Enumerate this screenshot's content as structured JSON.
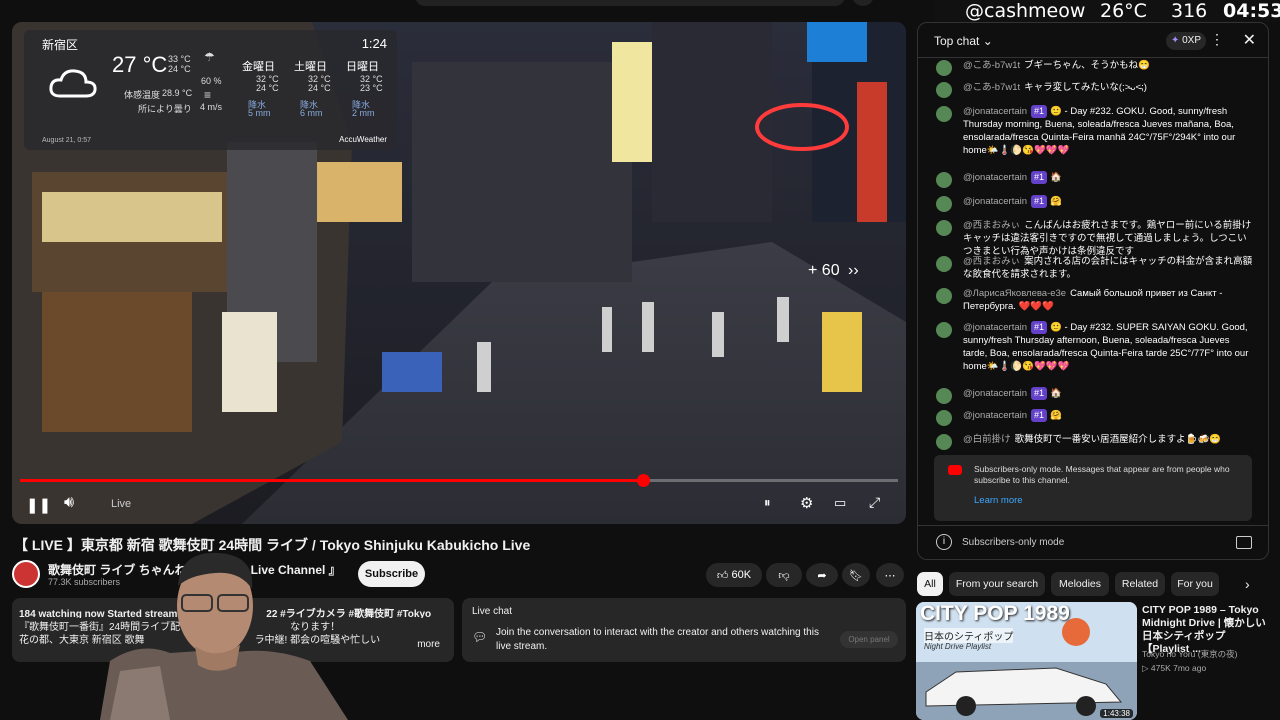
{
  "stream_overlay": {
    "handle": "@cashmeow",
    "temp": "26°C",
    "count": "316",
    "clock": "04:53"
  },
  "video": {
    "weather": {
      "location": "新宿区",
      "time": "1:24",
      "temp": "27 °C",
      "hi": "33 °C",
      "lo": "24 °C",
      "rain_pct": "60 %",
      "feels_label": "体感温度",
      "feels": "28.9 °C",
      "condition": "所により曇り",
      "wind": "4 m/s",
      "days": [
        {
          "label": "金曜日",
          "hi": "32 °C",
          "lo": "24 °C",
          "rain_label": "降水",
          "rain": "5 mm"
        },
        {
          "label": "土曜日",
          "hi": "32 °C",
          "lo": "24 °C",
          "rain_label": "降水",
          "rain": "6 mm"
        },
        {
          "label": "日曜日",
          "hi": "32 °C",
          "lo": "23 °C",
          "rain_label": "降水",
          "rain": "2 mm"
        }
      ],
      "footer": "August 21, 0:57",
      "provider": "AccuWeather"
    },
    "seek_hint": "+ 60",
    "live_label": "Live",
    "progress": 0.71
  },
  "title": "【 LIVE 】東京都 新宿 歌舞伎町 24時間 ライブ / Tokyo Shinjuku Kabukicho Live",
  "channel": {
    "name": "歌舞伎町 ライブ ちゃんね",
    "name_end": "o Live Channel 』",
    "subs": "77.3K subscribers",
    "subscribe": "Subscribe"
  },
  "actions": {
    "likes": "60K"
  },
  "description": {
    "line1": "184 watching now  Started streamin",
    "line1b": "22  #ライブカメラ #歌舞伎町 #Tokyo",
    "line2": "『歌舞伎町一番街』24時間ライブ配",
    "line2b": "なります！",
    "line3": "花の都、大東京 新宿区 歌舞",
    "line3b": "ラ中継! 都会の喧騒や忙しい",
    "more": "more"
  },
  "live_chat_box": {
    "heading": "Live chat",
    "text": "Join the conversation to interact with the creator and others watching this live stream.",
    "open": "Open panel"
  },
  "chat": {
    "header": "Top chat",
    "xp": "0XP",
    "messages": [
      {
        "author": "@こあ-b7w1t",
        "text": "ブギーちゃん、そうかもね😁"
      },
      {
        "author": "@こあ-b7w1t",
        "text": "キャラ変してみたいな(;˃̵ᴗ˂̵;)"
      },
      {
        "author": "@jonatacertain",
        "badge": "#1",
        "text": "🙂 - Day #232. GOKU. Good, sunny/fresh Thursday morning, Buena, soleada/fresca Jueves mañana, Boa, ensolarada/fresca Quinta-Feira manhã 24C°/75F°/294K° into our home🌤️🌡️🌔😘💖💖💖"
      },
      {
        "author": "@jonatacertain",
        "badge": "#1",
        "text": "🏠"
      },
      {
        "author": "@jonatacertain",
        "badge": "#1",
        "text": "🤗"
      },
      {
        "author": "@西まおみぃ",
        "text": "こんばんはお疲れさまです。鶏ヤロー前にいる前掛けキャッチは違法客引きですので無視して通過しましょう。しつこいつきまとい行為や声かけは条例違反です"
      },
      {
        "author": "@西まおみぃ",
        "text": "案内される店の会計にはキャッチの料金が含まれ高額な飲食代を請求されます。"
      },
      {
        "author": "@ЛарисаЯковлева-е3е",
        "text": "Самый большой привет из Санкт - Петербурга. ❤️❤️❤️"
      },
      {
        "author": "@jonatacertain",
        "badge": "#1",
        "text": "🙂 - Day #232. SUPER SAIYAN GOKU. Good, sunny/fresh Thursday afternoon, Buena, soleada/fresca Jueves tarde, Boa, ensolarada/fresca Quinta-Feira tarde 25C°/77F° into our home🌤️🌡️🌔😘💖💖💖"
      },
      {
        "author": "@jonatacertain",
        "badge": "#1",
        "text": "🏠"
      },
      {
        "author": "@jonatacertain",
        "badge": "#1",
        "text": "🤗"
      },
      {
        "author": "@白前掛け",
        "text": "歌舞伎町で一番安い居酒屋紹介しますよ🍺🍻😁"
      }
    ],
    "notice": "Subscribers-only mode. Messages that appear are from people who subscribe to this channel.",
    "learn_more": "Learn more",
    "footer": "Subscribers-only mode"
  },
  "chips": [
    "All",
    "From your search",
    "Melodies",
    "Related",
    "For you"
  ],
  "recommendation": {
    "thumb_title": "CITY POP 1989",
    "thumb_sub": "日本のシティポップ",
    "thumb_sub2": "Night Drive Playlist",
    "duration": "1:43:38",
    "title": "CITY POP 1989 – Tokyo Midnight Drive | 懐かしい日本シティポップ【Playlist ...",
    "channel": "Tokyo no Yoru (東京の夜)",
    "meta": "▷ 475K  7mo ago"
  }
}
